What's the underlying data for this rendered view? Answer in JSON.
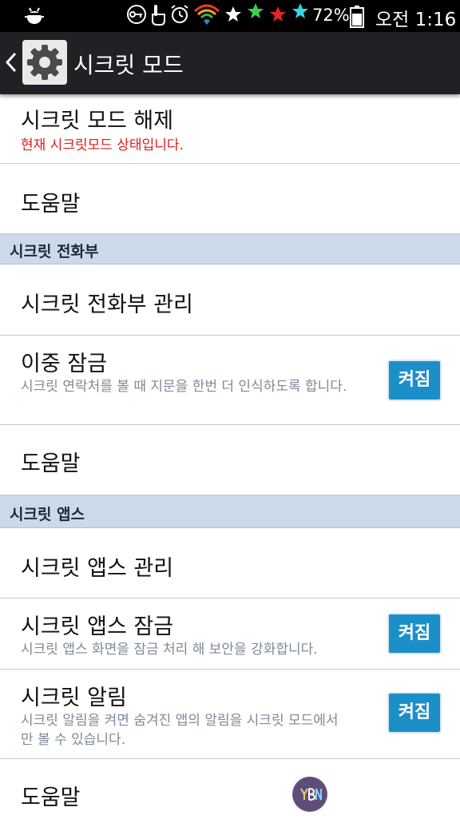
{
  "status_bar": {
    "battery_percent": "72%",
    "time": "오전 1:16",
    "icons": [
      "android-bug-icon",
      "key-icon",
      "touch-icon",
      "alarm-icon",
      "wifi-icon",
      "star-white-icon",
      "star-green-icon",
      "star-red-icon",
      "star-cyan-icon",
      "battery-icon"
    ]
  },
  "action_bar": {
    "title": "시크릿 모드",
    "icon": "gear-icon"
  },
  "rows": {
    "deactivate": {
      "title": "시크릿 모드 해제",
      "subtitle": "현재 시크릿모드 상태입니다."
    },
    "help1": {
      "title": "도움말"
    },
    "section_contacts": {
      "label": "시크릿 전화부"
    },
    "contacts_manage": {
      "title": "시크릿 전화부 관리"
    },
    "double_lock": {
      "title": "이중 잠금",
      "subtitle": "시크릿 연락처를 볼 때 지문을 한번 더 인식하도록 합니다.",
      "toggle": "켜짐"
    },
    "help2": {
      "title": "도움말"
    },
    "section_apps": {
      "label": "시크릿 앱스"
    },
    "apps_manage": {
      "title": "시크릿 앱스 관리"
    },
    "apps_lock": {
      "title": "시크릿 앱스 잠금",
      "subtitle": "시크릿 앱스 화면을 잠금 처리 해 보안을 강화합니다.",
      "toggle": "켜짐"
    },
    "notification": {
      "title": "시크릿 알림",
      "subtitle": "시크릿 알림을 켜면 숨겨진 앱의 알림을 시크릿 모드에서만 볼 수 있습니다.",
      "toggle": "켜짐"
    },
    "help3": {
      "title": "도움말"
    }
  },
  "colors": {
    "toggle_on": "#1c8fc8",
    "section_bg": "#ccd9e8",
    "warning_text": "#e21a1a",
    "action_bar": "#1f2124"
  }
}
